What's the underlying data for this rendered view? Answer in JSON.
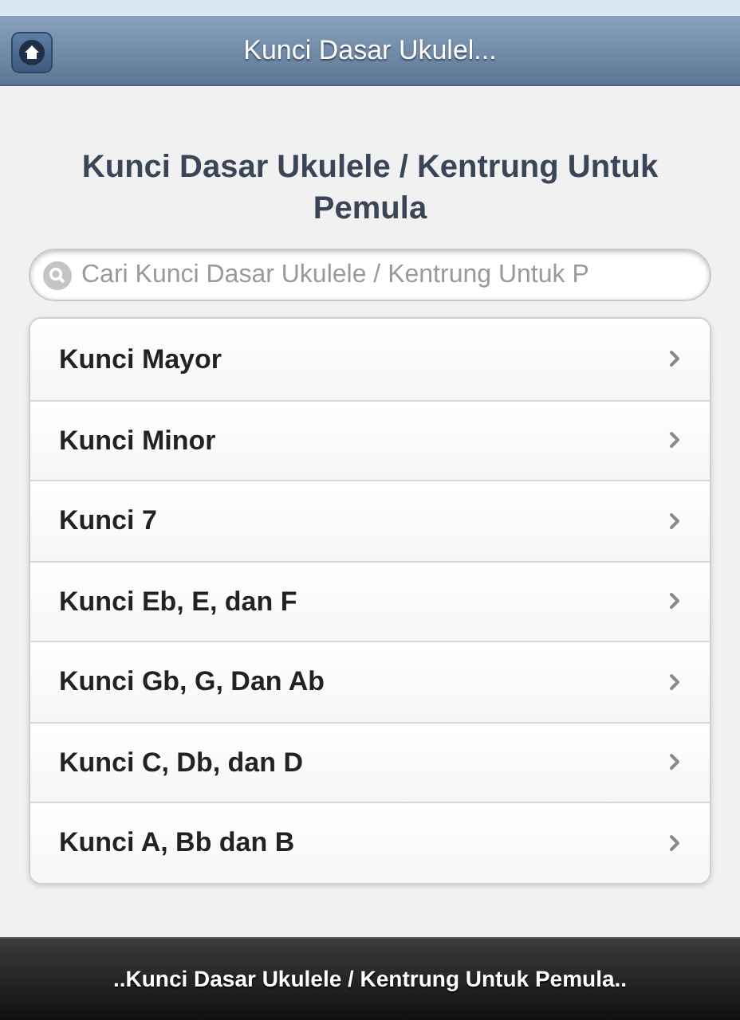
{
  "header": {
    "title": "Kunci Dasar Ukulel..."
  },
  "heading": "Kunci Dasar Ukulele / Kentrung Untuk Pemula",
  "search": {
    "placeholder": "Cari Kunci Dasar Ukulele / Kentrung Untuk P"
  },
  "items": [
    {
      "label": "Kunci Mayor"
    },
    {
      "label": "Kunci Minor"
    },
    {
      "label": "Kunci 7"
    },
    {
      "label": "Kunci Eb, E, dan F"
    },
    {
      "label": "Kunci Gb, G, Dan Ab"
    },
    {
      "label": "Kunci C, Db, dan D"
    },
    {
      "label": "Kunci A, Bb dan B"
    }
  ],
  "footer": "..Kunci Dasar Ukulele / Kentrung Untuk Pemula.."
}
